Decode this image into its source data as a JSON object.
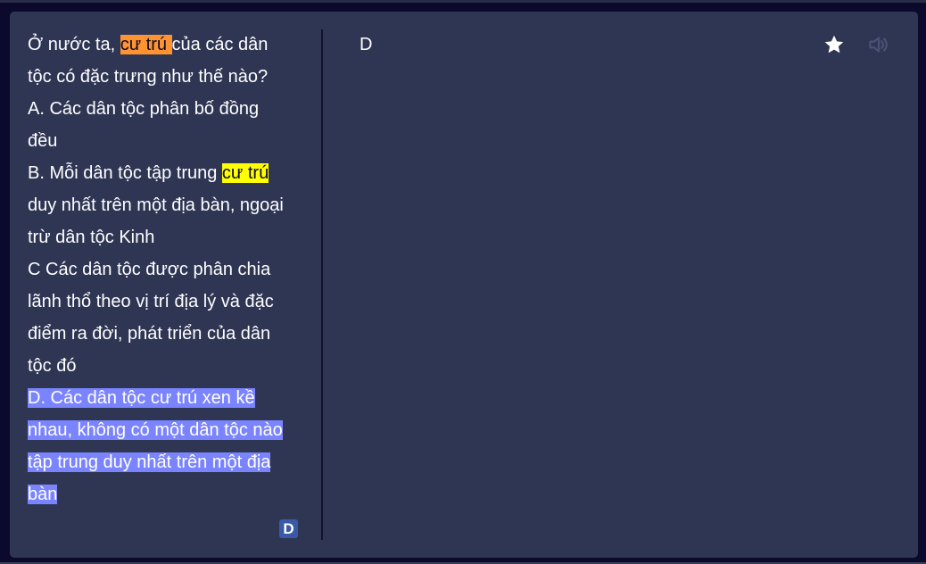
{
  "question": {
    "parts": [
      "Ở nước ta, ",
      "cư trú ",
      "của các dân tộc có đặc trưng như thế nào?"
    ]
  },
  "options": {
    "a": "A. Các dân tộc phân bố đồng đều",
    "b_parts": [
      "B. Mỗi dân tộc tập trung ",
      "cư trú ",
      "duy nhất trên một địa bàn, ngoại trừ dân tộc Kinh"
    ],
    "c": "C Các dân tộc được phân chia lãnh thổ theo vị trí địa lý và đặc điểm ra đời, phát triển của dân tộc đó",
    "d": "D. Các dân tộc cư trú xen kề nhau, không có một dân tộc nào tập trung duy nhất trên một địa bàn"
  },
  "badge": "D",
  "answer": "D",
  "icons": {
    "star": "star-icon",
    "speaker": "speaker-icon"
  },
  "colors": {
    "background": "#0b0a2c",
    "card": "#2f3654",
    "highlight_orange": "#ff9330",
    "highlight_yellow": "#ffff00",
    "selection": "#7b84ff"
  }
}
